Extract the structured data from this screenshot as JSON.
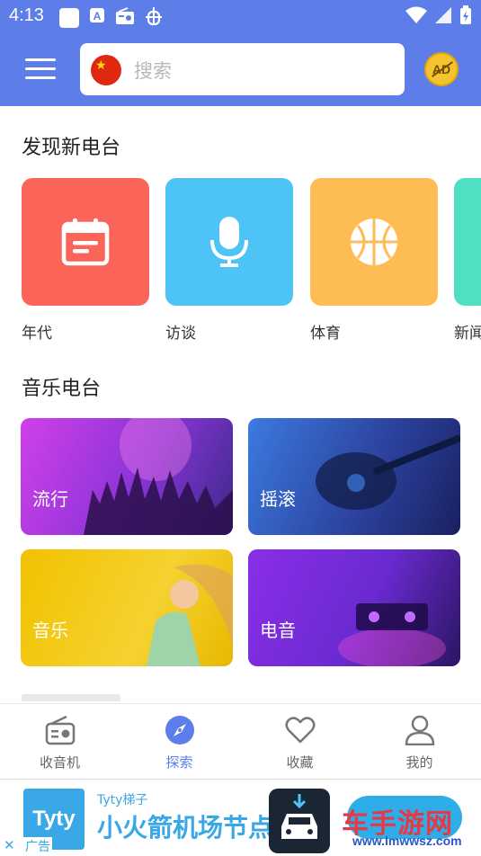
{
  "status_bar": {
    "time": "4:13"
  },
  "header": {
    "search_placeholder": "搜索",
    "ad_badge": "AD"
  },
  "discover": {
    "title": "发现新电台",
    "categories": [
      {
        "label": "年代",
        "color": "#fb6559",
        "icon": "calendar-icon"
      },
      {
        "label": "访谈",
        "color": "#4ec3f6",
        "icon": "microphone-icon"
      },
      {
        "label": "体育",
        "color": "#fdbd54",
        "icon": "basketball-icon"
      },
      {
        "label": "新闻",
        "color": "#4ee0c0",
        "icon": "news-icon"
      }
    ]
  },
  "music": {
    "title": "音乐电台",
    "cards": [
      {
        "label": "流行"
      },
      {
        "label": "摇滚"
      },
      {
        "label": "音乐"
      },
      {
        "label": "电音"
      }
    ]
  },
  "bottom_nav": {
    "items": [
      {
        "label": "收音机",
        "icon": "radio-icon",
        "active": false
      },
      {
        "label": "探索",
        "icon": "compass-icon",
        "active": true
      },
      {
        "label": "收藏",
        "icon": "heart-icon",
        "active": false
      },
      {
        "label": "我的",
        "icon": "person-icon",
        "active": false
      }
    ]
  },
  "ad_banner": {
    "logo_text": "Tyty",
    "brand": "Tyty梯子",
    "slogan": "小火箭机场节点",
    "close": "✕",
    "tag": "广告",
    "watermark": "车手游网",
    "watermark_url": "www.lmwwsz.com"
  },
  "colors": {
    "accent": "#5d7de8"
  }
}
